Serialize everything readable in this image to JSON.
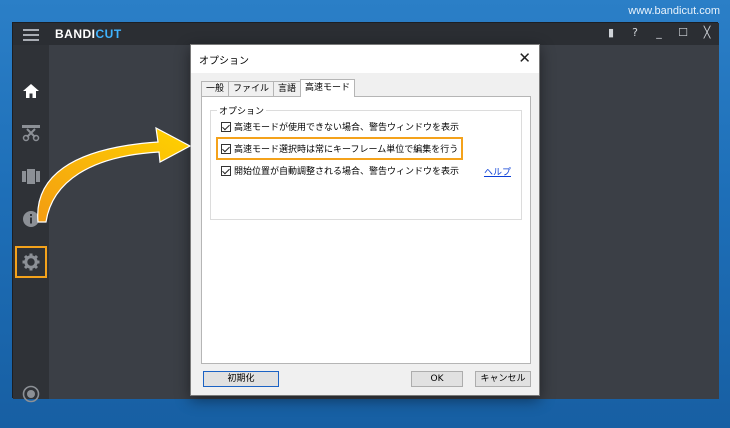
{
  "site": {
    "url": "www.bandicut.com"
  },
  "app": {
    "brand_main": "BANDI",
    "brand_accent": "CUT",
    "accent_color": "#3fb3ff",
    "highlight_color": "#f4a21b",
    "title_controls": [
      {
        "name": "folder-icon",
        "glyph": "▮"
      },
      {
        "name": "help-icon",
        "glyph": "?"
      },
      {
        "name": "minimize-icon",
        "glyph": "_"
      },
      {
        "name": "maximize-icon",
        "glyph": "☐"
      },
      {
        "name": "close-icon",
        "glyph": "╳"
      }
    ],
    "sidebar": [
      {
        "name": "home-icon"
      },
      {
        "name": "cut-icon"
      },
      {
        "name": "join-icon"
      },
      {
        "name": "info-icon"
      },
      {
        "name": "settings-icon",
        "selected": true
      },
      {
        "name": "record-icon"
      }
    ]
  },
  "dialog": {
    "title": "オプション",
    "close_glyph": "✕",
    "tabs": [
      "一般",
      "ファイル",
      "言語",
      "高速モード"
    ],
    "active_tab": "高速モード",
    "group_label": "オプション",
    "options": [
      {
        "label": "高速モードが使用できない場合、警告ウィンドウを表示",
        "checked": true
      },
      {
        "label": "高速モード選択時は常にキーフレーム単位で編集を行う",
        "checked": true,
        "highlighted": true
      },
      {
        "label": "開始位置が自動調整される場合、警告ウィンドウを表示",
        "checked": true
      }
    ],
    "help_link": "ヘルプ",
    "buttons": {
      "reset": "初期化",
      "ok": "OK",
      "cancel": "キャンセル"
    }
  }
}
